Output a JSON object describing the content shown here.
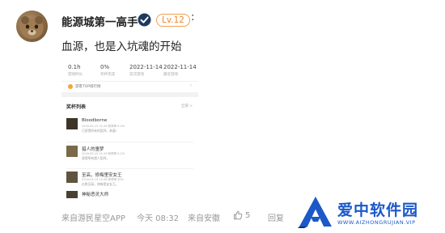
{
  "post": {
    "author": "能源城第一高手",
    "level": "Lv.12",
    "colon": ":",
    "text": "血源，也是入坑魂的开始"
  },
  "screenshot": {
    "stats": [
      {
        "value": "0.1h",
        "label": "游戏时长"
      },
      {
        "value": "0%",
        "label": "奖杯完成"
      },
      {
        "value": "2022-11-14",
        "label": "首次游戏"
      },
      {
        "value": "2022-11-14",
        "label": "最近游戏"
      }
    ],
    "rank_label": "游客TOP排行榜",
    "trophy_list_title": "奖杯列表",
    "trophy_list_more": "全部 >",
    "trophies": [
      {
        "name": "Bloodborne",
        "meta": "2016-05-15 21:49   获得率 8.5%",
        "desc": "已获得所有的奖杯。恭喜!"
      },
      {
        "name": "猎人的噩梦",
        "meta": "2016-05-15 21:49   获得率 8.2%",
        "desc": "获得所有猎人奖杯。"
      },
      {
        "name": "至高，修梅里安女王",
        "meta": "2016-04-15 15:46   获得率 60%",
        "desc": "击败至高，修梅里安女王。"
      },
      {
        "name": "神秘恶灵大师",
        "meta": "",
        "desc": ""
      }
    ]
  },
  "footer": {
    "source": "来自游民星空APP",
    "time": "今天 08:32",
    "location": "来自安徽",
    "likes": "5",
    "reply": "回复"
  },
  "watermark": {
    "title": "爱中软件园",
    "url": "WWW.AIZHONGRUJIAN.VIP"
  },
  "colors": {
    "accent_orange": "#f08a2a",
    "verified_blue": "#1da1f2",
    "watermark_blue": "#1b58c8"
  }
}
